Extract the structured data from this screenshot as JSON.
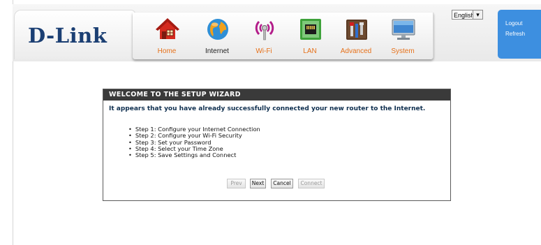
{
  "brand": {
    "logo_text": "D-Link"
  },
  "nav": {
    "items": [
      {
        "label": "Home",
        "icon": "home-icon",
        "active": false
      },
      {
        "label": "Internet",
        "icon": "globe-icon",
        "active": true
      },
      {
        "label": "Wi-Fi",
        "icon": "wifi-icon",
        "active": false
      },
      {
        "label": "LAN",
        "icon": "lan-port-icon",
        "active": false
      },
      {
        "label": "Advanced",
        "icon": "tools-icon",
        "active": false
      },
      {
        "label": "System",
        "icon": "monitor-icon",
        "active": false
      }
    ]
  },
  "language": {
    "selected": "English"
  },
  "side_panel": {
    "logout": "Logout",
    "refresh": "Refresh"
  },
  "wizard": {
    "title": "WELCOME TO THE SETUP WIZARD",
    "message": "It appears that you have already successfully connected your new router to the Internet.",
    "steps": [
      "Step 1: Configure your Internet Connection",
      "Step 2: Configure your Wi-Fi Security",
      "Step 3: Set your Password",
      "Step 4: Select your Time Zone",
      "Step 5: Save Settings and Connect"
    ],
    "buttons": {
      "prev": "Prev",
      "next": "Next",
      "cancel": "Cancel",
      "connect": "Connect"
    }
  },
  "colors": {
    "nav_label": "#e6711a",
    "brand": "#1b3f73",
    "side_panel": "#3d8fe0",
    "wizard_header": "#3a3a3a"
  }
}
